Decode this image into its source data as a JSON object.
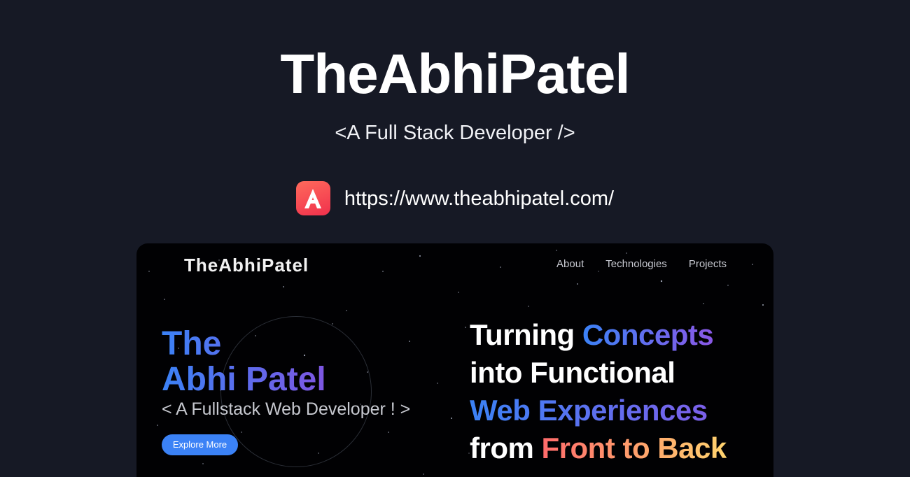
{
  "header": {
    "title": "TheAbhiPatel",
    "subtitle": "<A Full Stack Developer />",
    "url": "https://www.theabhipatel.com/",
    "logo_letter": "A",
    "logo_icon": "letter-a-logo-icon"
  },
  "preview": {
    "brand": "TheAbhiPatel",
    "nav": [
      "About",
      "Technologies",
      "Projects"
    ],
    "hero": {
      "name_line1": "The",
      "name_line2": "Abhi Patel",
      "role": "< A Fullstack Web Developer ! >",
      "button_label": "Explore More"
    },
    "headline": {
      "line1_a": "Turning ",
      "line1_b": "Concepts",
      "line2": "into Functional",
      "line3": "Web Experiences",
      "line4_a": "from ",
      "line4_b": "Front to Back"
    }
  },
  "colors": {
    "background": "#161925",
    "preview_background": "#010103",
    "accent_blue": "#3b82f6",
    "accent_purple": "#8a58e6",
    "logo_red": "#f0304c",
    "warm_start": "#ff6b6b",
    "warm_end": "#ffd36e"
  }
}
